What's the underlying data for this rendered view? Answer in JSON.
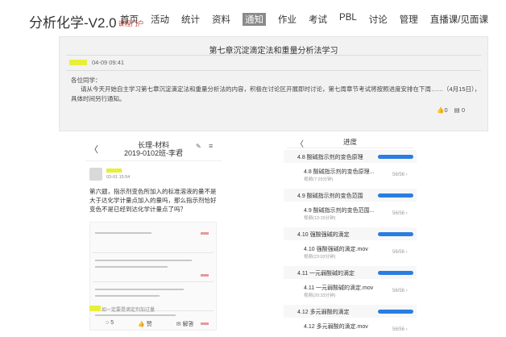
{
  "header": {
    "brand": "分析化学-V2.0",
    "brand_sub": "课程门户",
    "nav": [
      "首页",
      "活动",
      "统计",
      "资料",
      "通知",
      "作业",
      "考试",
      "PBL",
      "讨论",
      "管理",
      "直播课/见面课"
    ],
    "active_nav": "通知"
  },
  "notice": {
    "title": "第七章沉淀滴定法和重量分析法学习",
    "time": "04-09 09:41",
    "greeting": "各位同学：",
    "body": "请从今天开始自主学习第七章沉淀滴定法和重量分析法的内容，积极在讨论区开展即时讨论，第七周章节考试将按照进度安排在下周……（4月15日），具体时间另行通知。",
    "likes": "0",
    "comments": "0"
  },
  "phone_left": {
    "title_line1": "长理-材料",
    "title_line2": "2019-0102班-李君",
    "post_time": "03-01 15:54",
    "question": "第六题，指示剂变色所加入的标准溶液的量不是大于达化学计量点加入的量吗，那么指示剂恰好变色不是已经到达化学计量点了吗？",
    "highlight_text": "如一定要是滴定剂加过量",
    "comment_count": "5",
    "footer_mid": "赞",
    "footer_right": "解答"
  },
  "phone_right": {
    "title": "进度",
    "sections": [
      {
        "label": "4.8 酸碱指示剂的变色原理",
        "sub_title": "4.8 酸碱指示剂的变色原理...",
        "sub_info": "视频(7:25分钟)",
        "count": "56/56"
      },
      {
        "label": "4.9 酸碱指示剂的变色范围",
        "sub_title": "4.9 酸碱指示剂的变色范围...",
        "sub_info": "视频(13:15分钟)",
        "count": "56/56"
      },
      {
        "label": "4.10 强酸强碱的滴定",
        "sub_title": "4.10 强酸强碱的滴定.mov",
        "sub_info": "视频(23:03分钟)",
        "count": "56/56"
      },
      {
        "label": "4.11 一元弱酸碱的滴定",
        "sub_title": "4.11 一元弱酸碱的滴定.mov",
        "sub_info": "视频(20:33分钟)",
        "count": "56/56"
      },
      {
        "label": "4.12 多元弱酸的滴定",
        "sub_title": "4.12 多元弱酸的滴定.mov",
        "sub_info": "",
        "count": "56/56"
      }
    ],
    "progress_label": "100%"
  }
}
